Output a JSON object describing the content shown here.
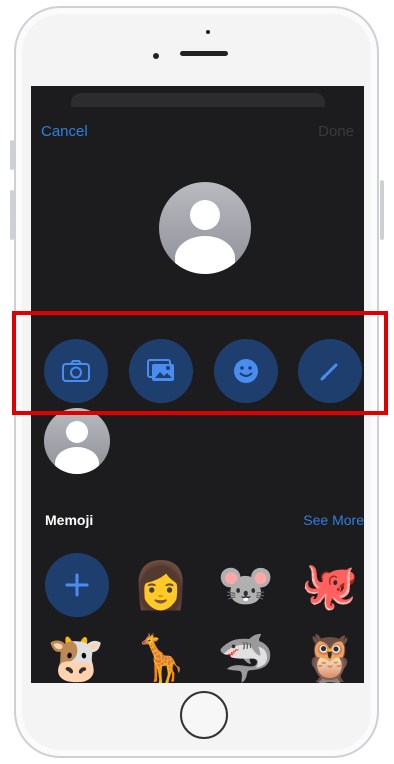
{
  "nav": {
    "cancel_label": "Cancel",
    "done_label": "Done"
  },
  "actions": [
    {
      "name": "camera",
      "icon": "camera-icon"
    },
    {
      "name": "photos",
      "icon": "photos-icon"
    },
    {
      "name": "emoji",
      "icon": "smiley-icon"
    },
    {
      "name": "edit",
      "icon": "pencil-icon"
    }
  ],
  "memoji": {
    "section_label": "Memoji",
    "see_more_label": "See More",
    "items": [
      {
        "name": "add",
        "icon": "plus-icon"
      },
      {
        "name": "memoji-girl",
        "glyph": "👩"
      },
      {
        "name": "mouse",
        "glyph": "🐭"
      },
      {
        "name": "octopus",
        "glyph": "🐙"
      },
      {
        "name": "cow",
        "glyph": "🐮"
      },
      {
        "name": "giraffe",
        "glyph": "🦒"
      },
      {
        "name": "shark",
        "glyph": "🦈"
      },
      {
        "name": "owl",
        "glyph": "🦉"
      }
    ]
  },
  "colors": {
    "accent": "#2f7fe0",
    "button_bg": "#1e3f6e",
    "screen_bg": "#1c1c1e",
    "highlight": "#e00000"
  }
}
